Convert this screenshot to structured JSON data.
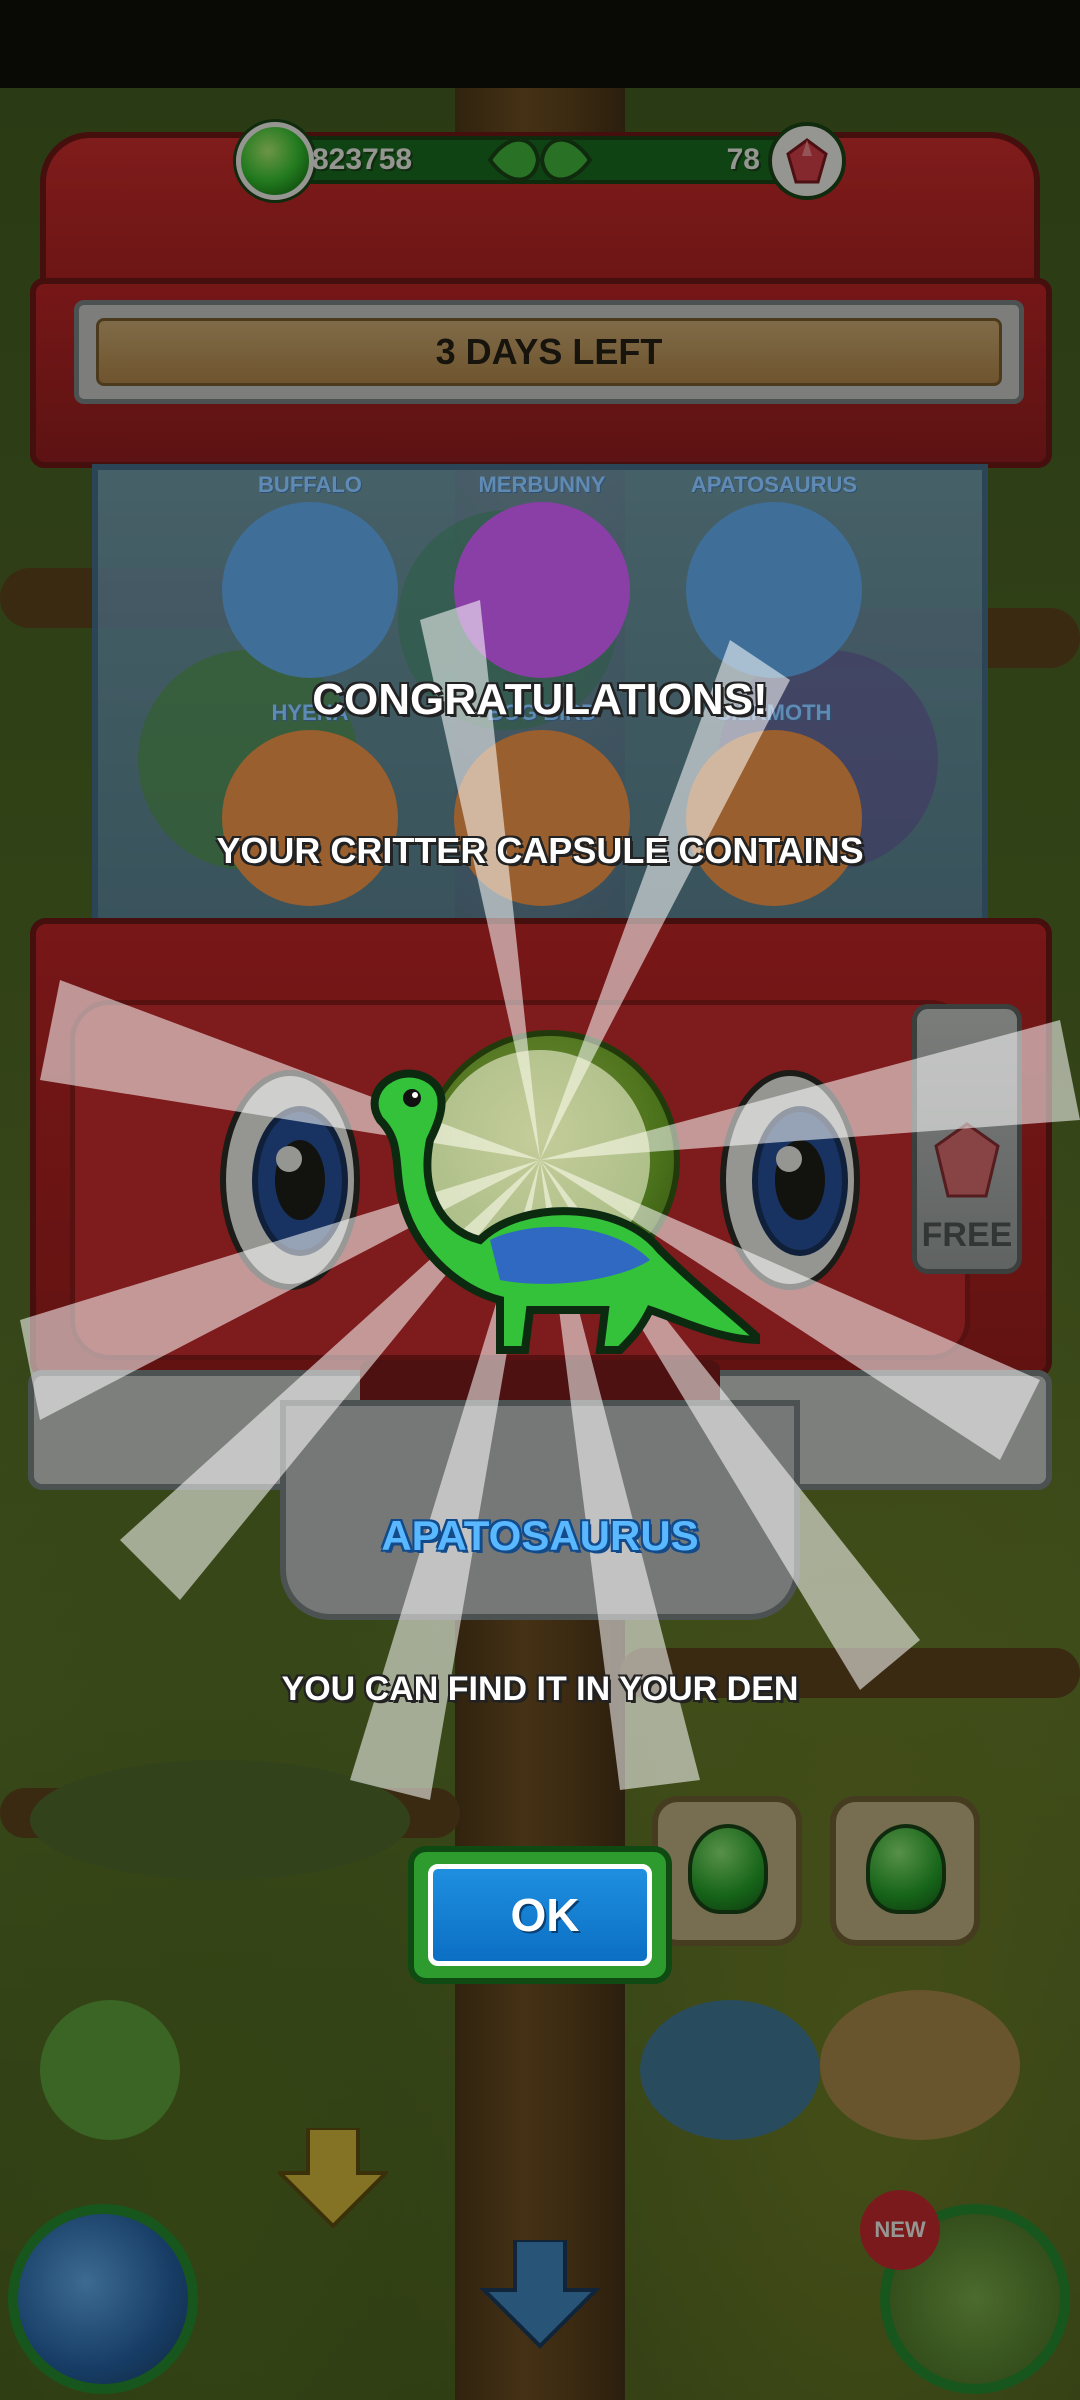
{
  "currency": {
    "coins": "823758",
    "gems": "78"
  },
  "machine": {
    "banner_text": "3 DAYS LEFT",
    "free_label": "FREE"
  },
  "capsule_contents": [
    {
      "name": "BUFFALO",
      "color": "#3f6f99"
    },
    {
      "name": "MERBUNNY",
      "color": "#8a3fa6"
    },
    {
      "name": "APATOSAURUS",
      "color": "#3f6f99"
    },
    {
      "name": "HYENA",
      "color": "#9a5f2e"
    },
    {
      "name": "BOG BIRD",
      "color": "#9a5f2e"
    },
    {
      "name": "SILKMOTH",
      "color": "#9a5f2e"
    }
  ],
  "reward": {
    "congrats": "CONGRATULATIONS!",
    "subtitle": "YOUR CRITTER CAPSULE CONTAINS",
    "critter_name": "APATOSAURUS",
    "den_text": "YOU CAN FIND IT IN YOUR DEN",
    "ok_label": "OK"
  },
  "nav": {
    "new_badge": "NEW"
  }
}
